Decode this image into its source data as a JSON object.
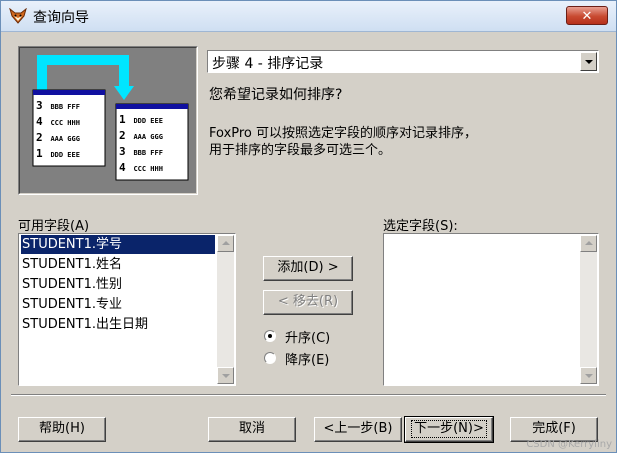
{
  "window": {
    "title": "查询向导",
    "close_label": "✕"
  },
  "step_combo": {
    "selected": "步骤 4 - 排序记录"
  },
  "question": "您希望记录如何排序?",
  "description": {
    "line1": "FoxPro 可以按照选定字段的顺序对记录排序，",
    "line2": "用于排序的字段最多可选三个。"
  },
  "illustration": {
    "left_card": [
      {
        "num": "3",
        "text": "BBB FFF"
      },
      {
        "num": "4",
        "text": "CCC HHH"
      },
      {
        "num": "2",
        "text": "AAA GGG"
      },
      {
        "num": "1",
        "text": "DDD EEE"
      }
    ],
    "right_card": [
      {
        "num": "1",
        "text": "DDD EEE"
      },
      {
        "num": "2",
        "text": "AAA GGG"
      },
      {
        "num": "3",
        "text": "BBB FFF"
      },
      {
        "num": "4",
        "text": "CCC HHH"
      }
    ]
  },
  "available_fields": {
    "label": "可用字段(A)",
    "items": [
      "STUDENT1.学号",
      "STUDENT1.姓名",
      "STUDENT1.性别",
      "STUDENT1.专业",
      "STUDENT1.出生日期"
    ],
    "selected_index": 0
  },
  "selected_fields": {
    "label": "选定字段(S):",
    "items": []
  },
  "buttons": {
    "add": "添加(D) >",
    "remove": "< 移去(R)",
    "help": "帮助(H)",
    "cancel": "取消",
    "back": "<上一步(B)",
    "next": "下一步(N)>",
    "finish": "完成(F)"
  },
  "sort_order": {
    "ascending": "升序(C)",
    "descending": "降序(E)",
    "selected": "ascending"
  },
  "watermark": "CSDN @Kerryliny"
}
